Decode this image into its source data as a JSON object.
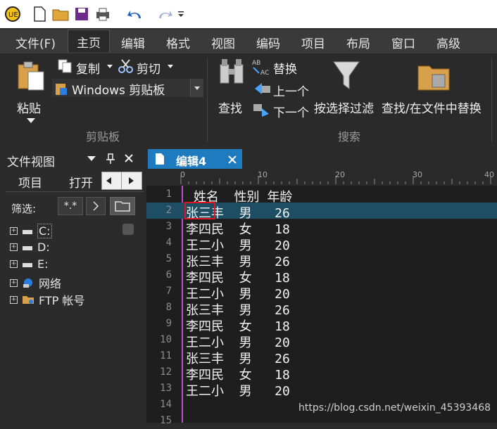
{
  "qat": {
    "icons": [
      "app-logo",
      "new-file",
      "open-folder",
      "save",
      "print",
      "undo",
      "redo",
      "customize"
    ]
  },
  "menu": {
    "items": [
      "文件(F)",
      "主页",
      "编辑",
      "格式",
      "视图",
      "编码",
      "项目",
      "布局",
      "窗口",
      "高级"
    ],
    "active": "主页"
  },
  "ribbon": {
    "paste": "粘贴",
    "copy": "复制",
    "cut": "剪切",
    "clipboard_select": "Windows 剪贴板",
    "group_clipboard": "剪贴板",
    "find": "查找",
    "replace": "替换",
    "prev": "上一个",
    "next": "下一个",
    "filter": "按选择过滤",
    "find_in_files": "查找/在文件中替换",
    "group_search": "搜索"
  },
  "fileview": {
    "title": "文件视图",
    "tabs": [
      "项目",
      "打开"
    ],
    "filter_label": "筛选:",
    "filter_value": "*.*",
    "tree": [
      "C:",
      "D:",
      "E:",
      "网络",
      "FTP 帐号"
    ]
  },
  "editor": {
    "tab_title": "编辑4",
    "ruler": [
      "0",
      "10",
      "20",
      "30",
      "40"
    ],
    "lines": [
      {
        "n": "1",
        "t": " 姓名  性别 年龄"
      },
      {
        "n": "2",
        "t": "张三丰  男   26"
      },
      {
        "n": "3",
        "t": "李四民  女   18"
      },
      {
        "n": "4",
        "t": "王二小  男   20"
      },
      {
        "n": "5",
        "t": "张三丰  男   26"
      },
      {
        "n": "6",
        "t": "李四民  女   18"
      },
      {
        "n": "7",
        "t": "王二小  男   20"
      },
      {
        "n": "8",
        "t": "张三丰  男   26"
      },
      {
        "n": "9",
        "t": "李四民  女   18"
      },
      {
        "n": "10",
        "t": "王二小  男   20"
      },
      {
        "n": "11",
        "t": "张三丰  男   26"
      },
      {
        "n": "12",
        "t": "李四民  女   18"
      },
      {
        "n": "13",
        "t": "王二小  男   20"
      },
      {
        "n": "14",
        "t": ""
      },
      {
        "n": "15",
        "t": ""
      }
    ],
    "watermark": "https://blog.csdn.net/weixin_45393468"
  }
}
